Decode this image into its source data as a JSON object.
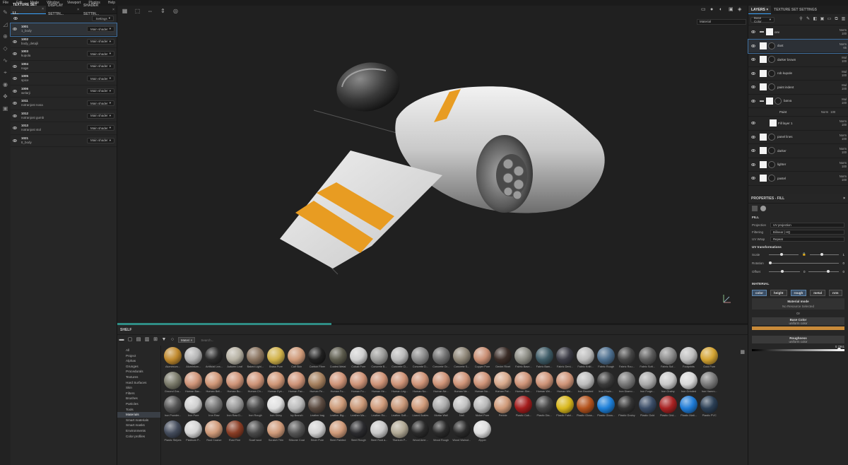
{
  "menu": [
    "File",
    "Edit",
    "Mode",
    "Window",
    "Viewport",
    "Plugins",
    "Help"
  ],
  "left_tabs": [
    {
      "label": "TEXTURE SET LI..."
    },
    {
      "label": "DISPLAY SETTIN..."
    },
    {
      "label": "SHADER SETTIN..."
    }
  ],
  "texture_sets": {
    "settings_label": "Settings",
    "rows": [
      {
        "id": "1001",
        "name": "1_body",
        "shader": "Main shader"
      },
      {
        "id": "1002",
        "name": "body_detajli",
        "shader": "Main shader"
      },
      {
        "id": "1003",
        "name": "kupola",
        "shader": "Main shader"
      },
      {
        "id": "1004",
        "name": "noge",
        "shader": "Main shader"
      },
      {
        "id": "1005",
        "name": "spice",
        "shader": "Main shader"
      },
      {
        "id": "1006",
        "name": "welarji",
        "shader": "Main shader"
      },
      {
        "id": "1011",
        "name": "notranjost nosa",
        "shader": "Main shader"
      },
      {
        "id": "1012",
        "name": "notranjost gumb",
        "shader": "Main shader"
      },
      {
        "id": "1013",
        "name": "notranjost stol",
        "shader": "Main shader"
      },
      {
        "id": "1021",
        "name": "tt_body",
        "shader": "Main shader"
      }
    ]
  },
  "viewport": {
    "material_mode": "Material",
    "progress_fraction": 0.34
  },
  "shelf": {
    "title": "SHELF",
    "filter_chip": "Materi",
    "search_placeholder": "Search...",
    "categories": [
      "All",
      "Project",
      "Alphas",
      "Grunges",
      "Procedurals",
      "Textures",
      "Hard Surfaces",
      "Skin",
      "Filters",
      "Brushes",
      "Particles",
      "Tools",
      "Materials",
      "Smart materials",
      "Smart masks",
      "Environments",
      "Color profiles"
    ],
    "selected_category": "Materials",
    "materials": [
      {
        "n": "Aluminium...",
        "c": "#c08a2e"
      },
      {
        "n": "Aluminium...",
        "c": "#b5b5b5"
      },
      {
        "n": "Artificial Lea...",
        "c": "#2a2a2a"
      },
      {
        "n": "Autumn Leaf",
        "c": "#b7b2a4"
      },
      {
        "n": "Baked Light...",
        "c": "#8a7460"
      },
      {
        "n": "Brass Pure",
        "c": "#d1b24a"
      },
      {
        "n": "Calf Skin",
        "c": "#cf9a79"
      },
      {
        "n": "Carbon Fiber",
        "c": "#202020"
      },
      {
        "n": "Coated Metal",
        "c": "#5b5a4c"
      },
      {
        "n": "Cobalt Pure",
        "c": "#cfcfcf"
      },
      {
        "n": "Concrete B...",
        "c": "#9a9a98"
      },
      {
        "n": "Concrete Cl...",
        "c": "#b9b9b9"
      },
      {
        "n": "Concrete D...",
        "c": "#8a8a8a"
      },
      {
        "n": "Concrete Gr...",
        "c": "#6e6e6e"
      },
      {
        "n": "Concrete S...",
        "c": "#8e8677"
      },
      {
        "n": "Copper Pure",
        "c": "#c98f74"
      },
      {
        "n": "Denim Rivet",
        "c": "#3a2c27"
      },
      {
        "n": "Fabric Base...",
        "c": "#8c8c84"
      },
      {
        "n": "Fabric Bam...",
        "c": "#3e5b66"
      },
      {
        "n": "Fabric Deni...",
        "c": "#3a3a44"
      },
      {
        "n": "Fabric Knitt...",
        "c": "#bcbcbc"
      },
      {
        "n": "Fabric Rough",
        "c": "#4c6e8e"
      },
      {
        "n": "Fabric Rou...",
        "c": "#444"
      },
      {
        "n": "Fabric Soft...",
        "c": "#5a5a5a"
      },
      {
        "n": "Fabric Suf...",
        "c": "#8a8a8a"
      },
      {
        "n": "Footprints",
        "c": "#bdbdbd"
      },
      {
        "n": "Gold Pure",
        "c": "#d3a332"
      },
      {
        "n": "Ground Gra...",
        "c": "#7a7a6a"
      },
      {
        "n": "Human Bac...",
        "c": "#cf9478"
      },
      {
        "n": "Human Bell...",
        "c": "#d09777"
      },
      {
        "n": "Human Bu...",
        "c": "#cf9478"
      },
      {
        "n": "Human Ch...",
        "c": "#cf9478"
      },
      {
        "n": "Human Eye...",
        "c": "#d09777"
      },
      {
        "n": "Human Fac...",
        "c": "#cf9478"
      },
      {
        "n": "Human Fe...",
        "c": "#a5805e"
      },
      {
        "n": "Human Fo...",
        "c": "#cf9478"
      },
      {
        "n": "Human Fo...",
        "c": "#cf9478"
      },
      {
        "n": "Human He...",
        "c": "#cf9478"
      },
      {
        "n": "Human Leg...",
        "c": "#cf9478"
      },
      {
        "n": "Human No...",
        "c": "#cf9478"
      },
      {
        "n": "Human Ne...",
        "c": "#cf9478"
      },
      {
        "n": "Human Ne...",
        "c": "#cf9478"
      },
      {
        "n": "Human No...",
        "c": "#cf9478"
      },
      {
        "n": "Human Pal...",
        "c": "#d7a88b"
      },
      {
        "n": "Human She...",
        "c": "#cf9478"
      },
      {
        "n": "Human Wri...",
        "c": "#cf9478"
      },
      {
        "n": "Human Wri...",
        "c": "#cf9478"
      },
      {
        "n": "Iron Brushed",
        "c": "#bdbdbd"
      },
      {
        "n": "Iron Chain...",
        "c": "#3a3a3a"
      },
      {
        "n": "Iron Diamo...",
        "c": "#777"
      },
      {
        "n": "Iron Forge...",
        "c": "#aaa"
      },
      {
        "n": "Iron Grainy",
        "c": "#c8c8c8"
      },
      {
        "n": "Iron Grinded",
        "c": "#d8d8d8"
      },
      {
        "n": "Iron Hamm...",
        "c": "#7a7a7a"
      },
      {
        "n": "Iron Powder...",
        "c": "#555"
      },
      {
        "n": "Iron Pure",
        "c": "#cfcfcf"
      },
      {
        "n": "Iron Raw",
        "c": "#777"
      },
      {
        "n": "Iron Raw D...",
        "c": "#999"
      },
      {
        "n": "Iron Rough",
        "c": "#4a4a4a"
      },
      {
        "n": "Iron Shiny",
        "c": "#e0e0e0"
      },
      {
        "n": "Ivy Branch",
        "c": "#bbb"
      },
      {
        "n": "Leather bag",
        "c": "#5a4a40"
      },
      {
        "n": "Leather Big...",
        "c": "#cc9a78"
      },
      {
        "n": "Leather Ma...",
        "c": "#c99776"
      },
      {
        "n": "Leather Ro...",
        "c": "#cf9a7a"
      },
      {
        "n": "Leather Soft...",
        "c": "#c89778"
      },
      {
        "n": "Lizard Scales",
        "c": "#cf9a79"
      },
      {
        "n": "Mortar Wall",
        "c": "#aaa"
      },
      {
        "n": "Nail",
        "c": "#c1c1c1"
      },
      {
        "n": "Nickel Pure",
        "c": "#b8b8b8"
      },
      {
        "n": "Pebble",
        "c": "#cf9a79"
      },
      {
        "n": "Plastic Cab...",
        "c": "#a41d1d"
      },
      {
        "n": "Plastic Dia...",
        "c": "#444"
      },
      {
        "n": "Plastic Fabri...",
        "c": "#d8b71c"
      },
      {
        "n": "Plastic Gloss...",
        "c": "#b4531d"
      },
      {
        "n": "Plastic Gloss...",
        "c": "#1d7fd8"
      },
      {
        "n": "Plastic Grainy",
        "c": "#333"
      },
      {
        "n": "Plastic Gold",
        "c": "#3a4c66"
      },
      {
        "n": "Plastic Grid...",
        "c": "#a82222"
      },
      {
        "n": "Plastic Matt...",
        "c": "#1f7bd6"
      },
      {
        "n": "Plastic PVC",
        "c": "#2b3f55"
      },
      {
        "n": "Plastic Stripes",
        "c": "#444c5c"
      },
      {
        "n": "Platinum P...",
        "c": "#d4d4d4"
      },
      {
        "n": "Rust Coarse",
        "c": "#cf9a79"
      },
      {
        "n": "Rust Fine",
        "c": "#8a3d25"
      },
      {
        "n": "Scarf wool",
        "c": "#4a4a4a"
      },
      {
        "n": "Scratch Thin",
        "c": "#cf9a79"
      },
      {
        "n": "Silicone Coat",
        "c": "#555"
      },
      {
        "n": "Silver Pure",
        "c": "#d2d2d2"
      },
      {
        "n": "Steel Painted",
        "c": "#cf9a79"
      },
      {
        "n": "Steel Rough",
        "c": "#2b2b2e"
      },
      {
        "n": "Steel Rust a...",
        "c": "#c9c9c9"
      },
      {
        "n": "Titanium P...",
        "c": "#b0a894"
      },
      {
        "n": "Wood Ame...",
        "c": "#2a2a2a"
      },
      {
        "n": "Wood Rough",
        "c": "#2a2a2a"
      },
      {
        "n": "Wood Walnut...",
        "c": "#2a2a2a"
      },
      {
        "n": "Zipper",
        "c": "#ddd"
      },
      {
        "n": "Zombie Bo...",
        "c": "#cf9a79"
      }
    ]
  },
  "layers_panel": {
    "tabs": [
      {
        "label": "LAYERS"
      },
      {
        "label": "TEXTURE SET SETTINGS"
      }
    ],
    "channel": "Base Color",
    "rows": [
      {
        "name": "cev",
        "blend": "Norm",
        "opacity": "100",
        "kind": "folder"
      },
      {
        "name": "dust",
        "blend": "Norm",
        "opacity": "65",
        "kind": "fill",
        "selected": true
      },
      {
        "name": "darker brown",
        "blend": "Mul",
        "opacity": "100",
        "kind": "fill"
      },
      {
        "name": "rob kupole",
        "blend": "Mul",
        "opacity": "100",
        "kind": "fill"
      },
      {
        "name": "paint indent",
        "blend": "Mul",
        "opacity": "100",
        "kind": "fill"
      },
      {
        "name": "barva",
        "blend": "Mul",
        "opacity": "100",
        "kind": "folder"
      },
      {
        "name": "Paint",
        "blend": "Norm",
        "opacity": "100",
        "kind": "effect"
      },
      {
        "name": "Fill layer 1",
        "blend": "Norm",
        "opacity": "100",
        "kind": "plain"
      },
      {
        "name": "panel lines",
        "blend": "Norm",
        "opacity": "100",
        "kind": "fill"
      },
      {
        "name": "darker",
        "blend": "Norm",
        "opacity": "100",
        "kind": "fill"
      },
      {
        "name": "lighter",
        "blend": "Norm",
        "opacity": "100",
        "kind": "fill"
      },
      {
        "name": "pastel",
        "blend": "Norm",
        "opacity": "100",
        "kind": "fill"
      }
    ]
  },
  "properties": {
    "title": "PROPERTIES - FILL",
    "fill_label": "FILL",
    "projection_label": "Projection",
    "projection_value": "UV projection",
    "filtering_label": "Filtering",
    "filtering_value": "Bilinear | HQ",
    "uvwrap_label": "UV Wrap",
    "uvwrap_value": "Repeat",
    "uvtrans_label": "UV transformations",
    "scale_label": "Scale",
    "scale_value": "1",
    "rotation_label": "Rotation",
    "rotation_value": "0",
    "offset_label": "Offset",
    "offset_value": "0",
    "material_label": "MATERIAL",
    "channels": [
      {
        "label": "color",
        "on": true
      },
      {
        "label": "height",
        "on": false
      },
      {
        "label": "rough",
        "on": true
      },
      {
        "label": "metal",
        "on": false
      },
      {
        "label": "nrm",
        "on": false
      }
    ],
    "material_mode_title": "Material mode",
    "material_mode_value": "No Resource Selected",
    "or_label": "Or",
    "base_color_title": "Base Color",
    "base_color_sub": "uniform color",
    "base_color_hex": "#c98b3a",
    "roughness_title": "Roughness",
    "roughness_sub": "uniform color",
    "roughness_value": "0.7961"
  }
}
